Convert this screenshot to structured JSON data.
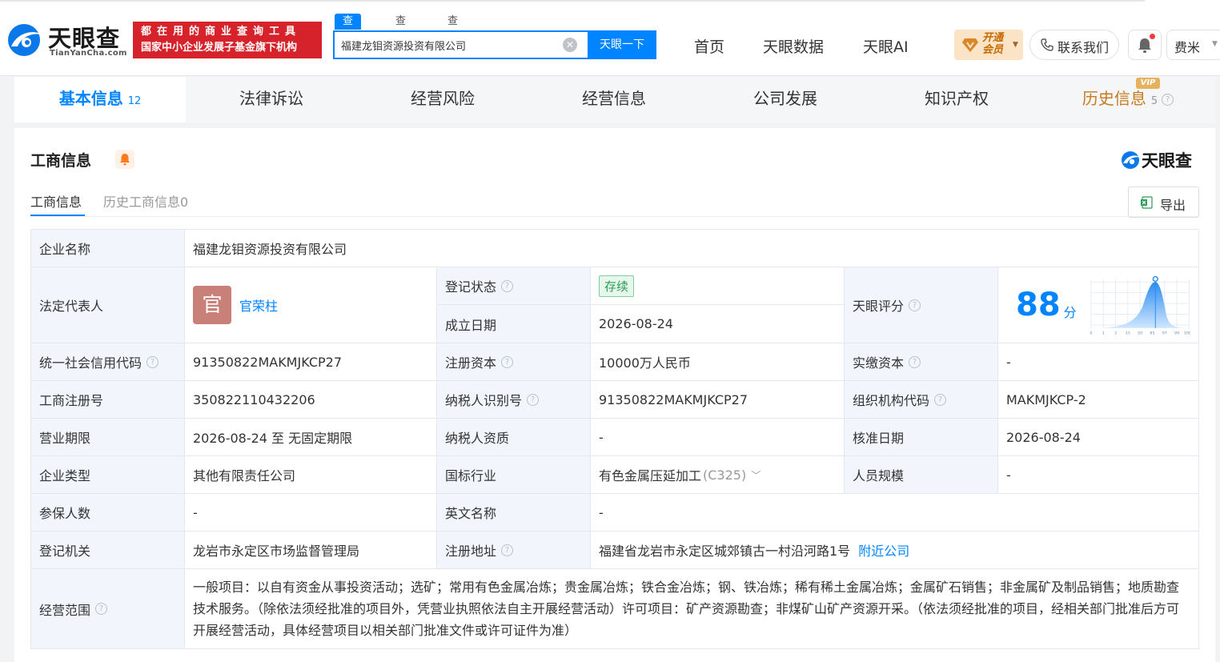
{
  "header": {
    "logo_cn": "天眼查",
    "logo_en": "TianYanCha.com",
    "slogan_line1": "都在用的商业查询工具",
    "slogan_line2": "国家中小企业发展子基金旗下机构",
    "search_tabs": [
      "查公司",
      "查老板",
      "查关系"
    ],
    "search_value": "福建龙钼资源投资有限公司",
    "search_button": "天眼一下",
    "nav": [
      "首页",
      "天眼数据",
      "天眼AI"
    ],
    "vip_line1": "开通",
    "vip_line2": "会员",
    "contact": "联系我们",
    "user": "费米"
  },
  "section_tabs": [
    {
      "label": "基本信息",
      "count": "12"
    },
    {
      "label": "法律诉讼"
    },
    {
      "label": "经营风险"
    },
    {
      "label": "经营信息"
    },
    {
      "label": "公司发展"
    },
    {
      "label": "知识产权"
    },
    {
      "label": "历史信息",
      "count": "5",
      "tag": "VIP"
    }
  ],
  "card": {
    "title": "工商信息",
    "brand": "天眼查",
    "sub_tabs": [
      "工商信息",
      "历史工商信息0"
    ],
    "export": "导出"
  },
  "info": {
    "company_name_label": "企业名称",
    "company_name": "福建龙钼资源投资有限公司",
    "legal_rep_label": "法定代表人",
    "legal_rep_avatar": "官",
    "legal_rep": "官荣柱",
    "reg_status_label": "登记状态",
    "reg_status": "存续",
    "found_date_label": "成立日期",
    "found_date": "2026-08-24",
    "score_label": "天眼评分",
    "score": "88",
    "score_unit": "分",
    "score_axis": [
      "0",
      "1",
      "3",
      "15",
      "50",
      "85",
      "97",
      "99",
      "100"
    ],
    "credit_code_label": "统一社会信用代码",
    "credit_code": "91350822MAKMJKCP27",
    "reg_capital_label": "注册资本",
    "reg_capital": "10000万人民币",
    "paid_capital_label": "实缴资本",
    "paid_capital": "-",
    "reg_no_label": "工商注册号",
    "reg_no": "350822110432206",
    "taxpayer_id_label": "纳税人识别号",
    "taxpayer_id": "91350822MAKMJKCP27",
    "org_code_label": "组织机构代码",
    "org_code": "MAKMJKCP-2",
    "term_label": "营业期限",
    "term": "2026-08-24 至 无固定期限",
    "taxpayer_qual_label": "纳税人资质",
    "taxpayer_qual": "-",
    "approve_date_label": "核准日期",
    "approve_date": "2026-08-24",
    "type_label": "企业类型",
    "type": "其他有限责任公司",
    "industry_label": "国标行业",
    "industry": "有色金属压延加工",
    "industry_code": "(C325)",
    "staff_size_label": "人员规模",
    "staff_size": "-",
    "insured_label": "参保人数",
    "insured": "-",
    "english_name_label": "英文名称",
    "english_name": "-",
    "authority_label": "登记机关",
    "authority": "龙岩市永定区市场监督管理局",
    "address_label": "注册地址",
    "address": "福建省龙岩市永定区城郊镇古一村沿河路1号",
    "nearby": "附近公司",
    "scope_label": "经营范围",
    "scope": "一般项目：以自有资金从事投资活动；选矿；常用有色金属冶炼；贵金属冶炼；铁合金冶炼；钢、铁冶炼；稀有稀土金属冶炼；金属矿石销售；非金属矿及制品销售；地质勘查技术服务。（除依法须经批准的项目外，凭营业执照依法自主开展经营活动）许可项目：矿产资源勘查；非煤矿山矿产资源开采。（依法须经批准的项目，经相关部门批准后方可开展经营活动，具体经营项目以相关部门批准文件或许可证件为准）"
  },
  "colors": {
    "accent": "#0084ff",
    "slogan_bg": "#d6222a",
    "status_green": "#28a050",
    "vip_gold": "#c87a1e"
  }
}
